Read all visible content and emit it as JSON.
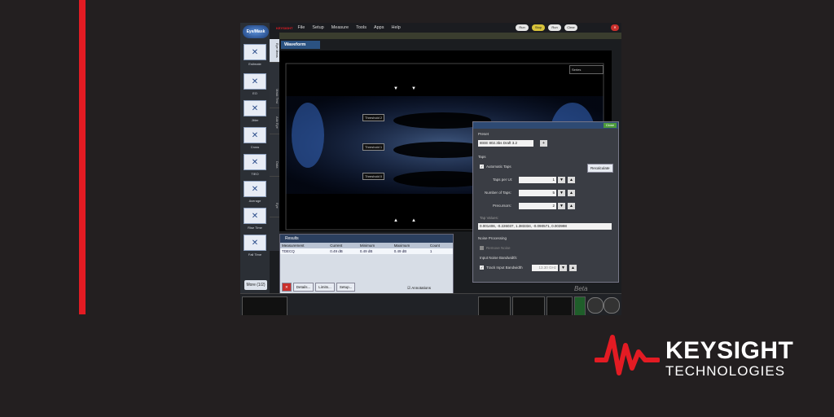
{
  "colors": {
    "brand_red": "#e31b23",
    "accent_blue": "#2b5281"
  },
  "left_tools": {
    "eye_mask": "Eye/Mask",
    "items": [
      "Estimate",
      "EO",
      "Jitter",
      "Cross",
      "TIEO",
      "Average",
      "Rise Time",
      "Fall Time"
    ],
    "more": "More (1/2)"
  },
  "vertical_tabs": [
    "Eye Meas",
    "Mask Test",
    "Adv Eye",
    "Data",
    "Eye"
  ],
  "menu": {
    "brand": "KEYSIGHT",
    "items": [
      "File",
      "Setup",
      "Measure",
      "Tools",
      "Apps",
      "Help"
    ],
    "right_buttons": [
      "Run",
      "Stop",
      "Run",
      "Clear"
    ]
  },
  "waveform_tab": "Waveform",
  "plot": {
    "thresholds": [
      "Threshold 2",
      "Threshold 1",
      "Threshold 0"
    ],
    "series_label": "Series",
    "beta": "Beta"
  },
  "results": {
    "tab": "Results",
    "headers": [
      "Measurement",
      "Current",
      "Minimum",
      "Maximum",
      "Count"
    ],
    "row": {
      "name": "TDECQ",
      "current": "0.49 dB",
      "minimum": "0.49 dB",
      "maximum": "0.49 dB",
      "count": "1"
    },
    "buttons": [
      "Details...",
      "Limits...",
      "Setup..."
    ],
    "annotations": "Annotations"
  },
  "dialog": {
    "close": "Close",
    "preset_label": "Preset",
    "preset_value": "IEEE 802.3bs Draft 3.2",
    "taps_label": "Taps",
    "auto_taps": "Automatic Taps",
    "recalculate": "Recalculate",
    "taps_per_ui": {
      "label": "Taps per UI:",
      "value": "1"
    },
    "num_taps": {
      "label": "Number of Taps:",
      "value": "5"
    },
    "precursors": {
      "label": "Precursors:",
      "value": "2"
    },
    "tap_values_label": "Tap Values:",
    "tap_values": "0.001406, -0.226037, 1.383334, -0.090571, 0.003998",
    "noise_label": "Noise Processing",
    "remove_noise": "Remove Noise",
    "input_bw_label": "Input Noise Bandwidth:",
    "track_bw": "Track Input Bandwidth",
    "bw_value": "13.30 GHz"
  },
  "logo": {
    "line1": "KEYSIGHT",
    "line2": "TECHNOLOGIES"
  }
}
